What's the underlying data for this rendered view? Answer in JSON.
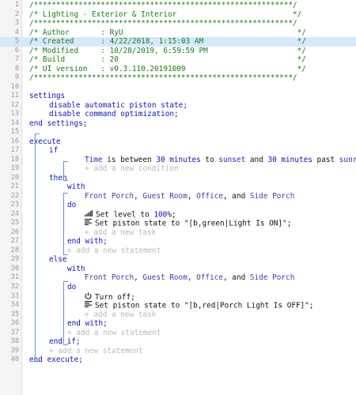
{
  "lines": [
    {
      "n": "1",
      "indent": 0,
      "parts": [
        {
          "c": "comment",
          "t": "/**********************************************************/"
        }
      ]
    },
    {
      "n": "2",
      "indent": 0,
      "parts": [
        {
          "c": "comment",
          "t": "/* Lighting - Exterior & Interior                          */"
        }
      ]
    },
    {
      "n": "3",
      "indent": 0,
      "parts": [
        {
          "c": "comment",
          "t": "/**********************************************************/"
        }
      ]
    },
    {
      "n": "4",
      "indent": 0,
      "parts": [
        {
          "c": "comment",
          "t": "/* Author       : RyU                                       */"
        }
      ]
    },
    {
      "n": "5",
      "indent": 0,
      "hl": true,
      "parts": [
        {
          "c": "comment",
          "t": "/* Created      : 4/22/2018, 1:15:03 AM                     */"
        }
      ]
    },
    {
      "n": "6",
      "indent": 0,
      "parts": [
        {
          "c": "comment",
          "t": "/* Modified     : 10/28/2019, 6:59:59 PM                    */"
        }
      ]
    },
    {
      "n": "7",
      "indent": 0,
      "parts": [
        {
          "c": "comment",
          "t": "/* Build        : 20                                        */"
        }
      ]
    },
    {
      "n": "8",
      "indent": 0,
      "parts": [
        {
          "c": "comment",
          "t": "/* UI version   : v0.3.110.20191009                         */"
        }
      ]
    },
    {
      "n": "9",
      "indent": 0,
      "parts": [
        {
          "c": "comment",
          "t": "/**********************************************************/"
        }
      ]
    },
    {
      "n": "10",
      "indent": 0,
      "parts": []
    },
    {
      "n": "11",
      "indent": 0,
      "parts": [
        {
          "c": "kw",
          "t": "settings"
        }
      ]
    },
    {
      "n": "12",
      "indent": 1,
      "parts": [
        {
          "c": "kw",
          "t": "disable automatic piston state;"
        }
      ]
    },
    {
      "n": "13",
      "indent": 1,
      "parts": [
        {
          "c": "kw",
          "t": "disable command optimization;"
        }
      ]
    },
    {
      "n": "14",
      "indent": 0,
      "parts": [
        {
          "c": "kw",
          "t": "end settings;"
        }
      ]
    },
    {
      "n": "15",
      "indent": 0,
      "parts": []
    },
    {
      "n": "16",
      "indent": 0,
      "parts": [
        {
          "c": "kw",
          "t": "execute"
        }
      ]
    },
    {
      "n": "17",
      "indent": 1,
      "parts": [
        {
          "c": "kw",
          "t": "if"
        }
      ]
    },
    {
      "n": "18",
      "indent": 3,
      "parts": [
        {
          "c": "var",
          "t": "Time"
        },
        {
          "c": "txt",
          "t": " is between "
        },
        {
          "c": "num",
          "t": "30 minutes"
        },
        {
          "c": "txt",
          "t": " to "
        },
        {
          "c": "var",
          "t": "sunset"
        },
        {
          "c": "txt",
          "t": " and "
        },
        {
          "c": "num",
          "t": "30 minutes"
        },
        {
          "c": "txt",
          "t": " past "
        },
        {
          "c": "var",
          "t": "sunrise"
        }
      ]
    },
    {
      "n": "19",
      "indent": 3,
      "parts": [
        {
          "c": "add",
          "t": "+ add a new condition"
        }
      ]
    },
    {
      "n": "20",
      "indent": 1,
      "parts": [
        {
          "c": "kw",
          "t": "then"
        }
      ]
    },
    {
      "n": "21",
      "indent": 2,
      "parts": [
        {
          "c": "kw",
          "t": "with"
        }
      ]
    },
    {
      "n": "22",
      "indent": 3,
      "parts": [
        {
          "c": "dev",
          "t": "Front Porch"
        },
        {
          "c": "txt",
          "t": ", "
        },
        {
          "c": "dev",
          "t": "Guest Room"
        },
        {
          "c": "txt",
          "t": ", "
        },
        {
          "c": "dev",
          "t": "Office"
        },
        {
          "c": "txt",
          "t": ", and "
        },
        {
          "c": "dev",
          "t": "Side Porch"
        }
      ]
    },
    {
      "n": "23",
      "indent": 2,
      "parts": [
        {
          "c": "kw",
          "t": "do"
        }
      ]
    },
    {
      "n": "24",
      "indent": 3,
      "icon": "signal-bars-icon",
      "parts": [
        {
          "c": "txt",
          "t": "Set level to "
        },
        {
          "c": "num",
          "t": "100"
        },
        {
          "c": "txt",
          "t": "%;"
        }
      ]
    },
    {
      "n": "25",
      "indent": 3,
      "icon": "list-lines-icon",
      "parts": [
        {
          "c": "txt",
          "t": "Set piston state to \""
        },
        {
          "c": "str",
          "t": "[b,green|Light Is ON]"
        },
        {
          "c": "txt",
          "t": "\";"
        }
      ]
    },
    {
      "n": "26",
      "indent": 3,
      "parts": [
        {
          "c": "add",
          "t": "+ add a new task"
        }
      ]
    },
    {
      "n": "27",
      "indent": 2,
      "parts": [
        {
          "c": "kw",
          "t": "end with;"
        }
      ]
    },
    {
      "n": "28",
      "indent": 2,
      "parts": [
        {
          "c": "add",
          "t": "+ add a new statement"
        }
      ]
    },
    {
      "n": "29",
      "indent": 1,
      "parts": [
        {
          "c": "kw",
          "t": "else"
        }
      ]
    },
    {
      "n": "30",
      "indent": 2,
      "parts": [
        {
          "c": "kw",
          "t": "with"
        }
      ]
    },
    {
      "n": "31",
      "indent": 3,
      "parts": [
        {
          "c": "dev",
          "t": "Front Porch"
        },
        {
          "c": "txt",
          "t": ", "
        },
        {
          "c": "dev",
          "t": "Guest Room"
        },
        {
          "c": "txt",
          "t": ", "
        },
        {
          "c": "dev",
          "t": "Office"
        },
        {
          "c": "txt",
          "t": ", and "
        },
        {
          "c": "dev",
          "t": "Side Porch"
        }
      ]
    },
    {
      "n": "32",
      "indent": 2,
      "parts": [
        {
          "c": "kw",
          "t": "do"
        }
      ]
    },
    {
      "n": "33",
      "indent": 3,
      "icon": "power-icon",
      "parts": [
        {
          "c": "txt",
          "t": "Turn off;"
        }
      ]
    },
    {
      "n": "34",
      "indent": 3,
      "icon": "list-lines-icon",
      "parts": [
        {
          "c": "txt",
          "t": "Set piston state to \""
        },
        {
          "c": "str",
          "t": "[b,red|Porch Light Is OFF]"
        },
        {
          "c": "txt",
          "t": "\";"
        }
      ]
    },
    {
      "n": "35",
      "indent": 3,
      "parts": [
        {
          "c": "add",
          "t": "+ add a new task"
        }
      ]
    },
    {
      "n": "36",
      "indent": 2,
      "parts": [
        {
          "c": "kw",
          "t": "end with;"
        }
      ]
    },
    {
      "n": "37",
      "indent": 2,
      "parts": [
        {
          "c": "add",
          "t": "+ add a new statement"
        }
      ]
    },
    {
      "n": "38",
      "indent": 1,
      "parts": [
        {
          "c": "kw",
          "t": "end if;"
        }
      ]
    },
    {
      "n": "39",
      "indent": 1,
      "parts": [
        {
          "c": "add",
          "t": "+ add a new statement"
        }
      ]
    },
    {
      "n": "40",
      "indent": 0,
      "parts": [
        {
          "c": "kw",
          "t": "end execute;"
        }
      ]
    }
  ]
}
